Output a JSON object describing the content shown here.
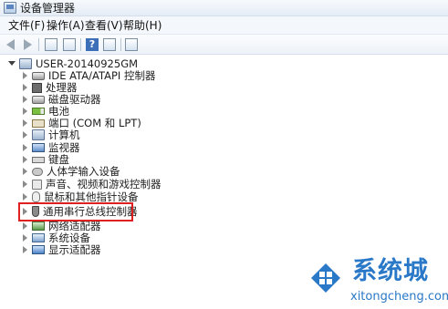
{
  "window": {
    "title": "设备管理器"
  },
  "menu": [
    "文件(F)",
    "操作(A)",
    "查看(V)",
    "帮助(H)"
  ],
  "tree": {
    "root": "USER-20140925GM",
    "items": [
      {
        "label": "IDE ATA/ATAPI 控制器",
        "icon": "ide-controller-icon"
      },
      {
        "label": "处理器",
        "icon": "processor-icon"
      },
      {
        "label": "磁盘驱动器",
        "icon": "disk-drive-icon"
      },
      {
        "label": "电池",
        "icon": "battery-icon"
      },
      {
        "label": "端口 (COM 和 LPT)",
        "icon": "port-icon"
      },
      {
        "label": "计算机",
        "icon": "computer-icon"
      },
      {
        "label": "监视器",
        "icon": "monitor-icon"
      },
      {
        "label": "键盘",
        "icon": "keyboard-icon"
      },
      {
        "label": "人体学输入设备",
        "icon": "hid-icon"
      },
      {
        "label": "声音、视频和游戏控制器",
        "icon": "sound-icon"
      },
      {
        "label": "鼠标和其他指针设备",
        "icon": "mouse-icon"
      },
      {
        "label": "通用串行总线控制器",
        "icon": "usb-icon"
      },
      {
        "label": "网络适配器",
        "icon": "network-adapter-icon"
      },
      {
        "label": "系统设备",
        "icon": "system-device-icon"
      },
      {
        "label": "显示适配器",
        "icon": "display-adapter-icon"
      }
    ]
  },
  "watermark": {
    "title": "系统城",
    "url": "xitongcheng.com"
  },
  "colors": {
    "highlight": "#e02020",
    "watermark": "#2a78c8"
  }
}
